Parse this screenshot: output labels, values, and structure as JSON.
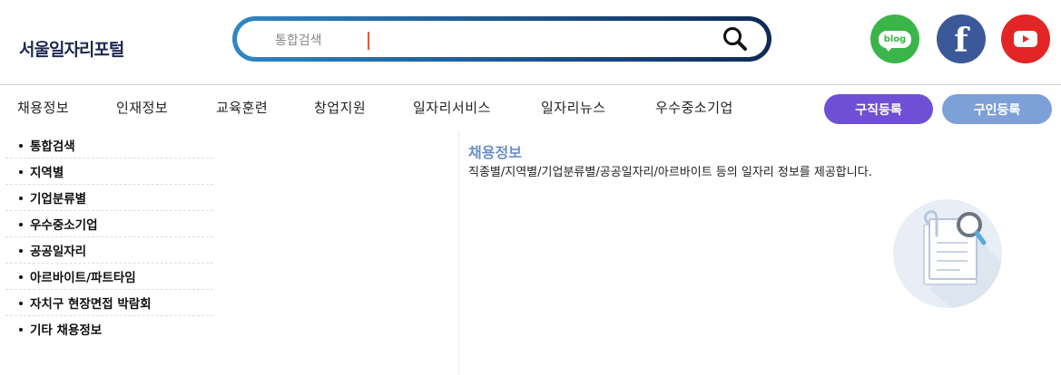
{
  "header": {
    "logo_text": "서울일자리포털",
    "search": {
      "placeholder": "통합검색",
      "value": ""
    },
    "sns": [
      {
        "name": "blog",
        "label": "blog",
        "color": "#3bb54a"
      },
      {
        "name": "facebook",
        "label": "f",
        "color": "#3b5998"
      },
      {
        "name": "youtube",
        "label": "",
        "color": "#e32525"
      }
    ]
  },
  "nav": {
    "items": [
      "채용정보",
      "인재정보",
      "교육훈련",
      "창업지원",
      "일자리서비스",
      "일자리뉴스",
      "우수중소기업"
    ],
    "job_seeker_register": "구직등록",
    "recruiter_register": "구인등록"
  },
  "sidebar": {
    "items": [
      "통합검색",
      "지역별",
      "기업분류별",
      "우수중소기업",
      "공공일자리",
      "아르바이트/파트타임",
      "자치구 현장면접 박람회",
      "기타 채용정보"
    ]
  },
  "content": {
    "title": "채용정보",
    "description": "직종별/지역별/기업분류별/공공일자리/아르바이트 등의 일자리 정보를 제공합니다."
  },
  "colors": {
    "accent_purple": "#6f4fd6",
    "accent_blue": "#7ea0d8",
    "title_blue": "#6a8fc8",
    "logo_navy": "#1f2a52"
  }
}
